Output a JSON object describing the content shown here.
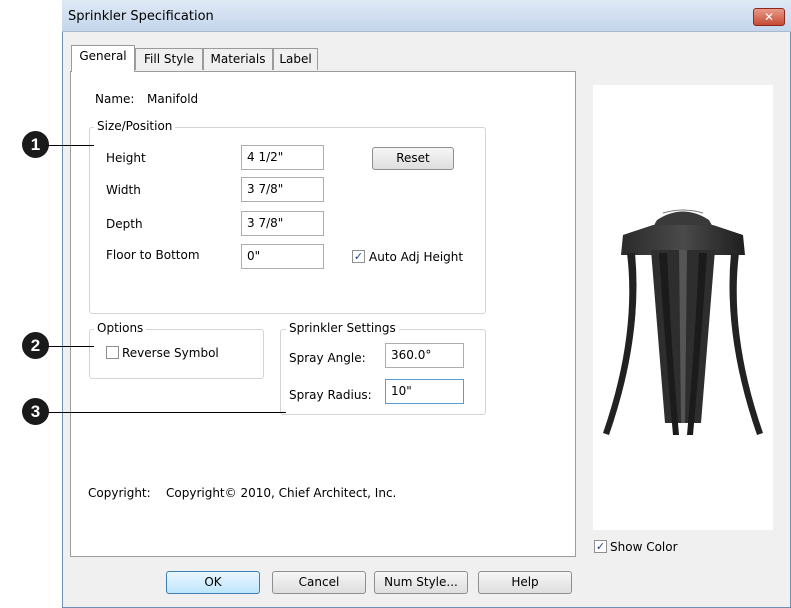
{
  "window": {
    "title": "Sprinkler Specification",
    "close_label": "✕"
  },
  "tabs": [
    {
      "label": "General",
      "active": true
    },
    {
      "label": "Fill Style"
    },
    {
      "label": "Materials"
    },
    {
      "label": "Label"
    }
  ],
  "general": {
    "name_label": "Name:",
    "name_value": "Manifold",
    "size_position": {
      "legend": "Size/Position",
      "height_label": "Height",
      "height_value": "4 1/2\"",
      "width_label": "Width",
      "width_value": "3 7/8\"",
      "depth_label": "Depth",
      "depth_value": "3 7/8\"",
      "floor_label": "Floor to Bottom",
      "floor_value": "0\"",
      "reset_label": "Reset",
      "auto_adj_label": "Auto Adj Height",
      "auto_adj_checked": true
    },
    "options": {
      "legend": "Options",
      "reverse_label": "Reverse Symbol",
      "reverse_checked": false
    },
    "sprinkler_settings": {
      "legend": "Sprinkler Settings",
      "spray_angle_label": "Spray Angle:",
      "spray_angle_value": "360.0°",
      "spray_radius_label": "Spray Radius:",
      "spray_radius_value": "10\""
    },
    "copyright_label": "Copyright:",
    "copyright_value": "Copyright© 2010, Chief Architect, Inc."
  },
  "preview": {
    "show_color_label": "Show Color",
    "show_color_checked": true
  },
  "buttons": {
    "ok": "OK",
    "cancel": "Cancel",
    "num_style": "Num Style...",
    "help": "Help"
  },
  "callouts": [
    "1",
    "2",
    "3"
  ],
  "check_mark": "✓"
}
